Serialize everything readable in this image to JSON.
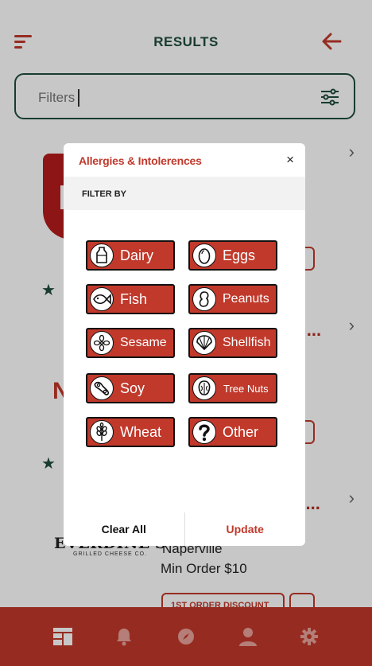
{
  "header": {
    "title": "RESULTS"
  },
  "filter": {
    "placeholder": "Filters"
  },
  "restaurants": [
    {
      "peek_name": "i ...",
      "logo_text": ""
    },
    {
      "peek_name": "ri ...",
      "logo_text": "N"
    },
    {
      "peek_name": "d ...",
      "logo_text": "EVERDINE'S",
      "logo_sub": "GRILLED CHEESE CO.",
      "location": "Naperville",
      "min_order": "Min Order $10",
      "badge": "1ST ORDER DISCOUNT"
    }
  ],
  "modal": {
    "title": "Allergies & Intolerences",
    "close_label": "×",
    "filter_by_label": "FILTER BY",
    "allergens": [
      {
        "label": "Dairy",
        "icon": "milk-bottle-icon"
      },
      {
        "label": "Eggs",
        "icon": "egg-icon"
      },
      {
        "label": "Fish",
        "icon": "fish-icon"
      },
      {
        "label": "Peanuts",
        "icon": "peanut-icon"
      },
      {
        "label": "Sesame",
        "icon": "sesame-icon"
      },
      {
        "label": "Shellfish",
        "icon": "shell-icon"
      },
      {
        "label": "Soy",
        "icon": "soy-icon"
      },
      {
        "label": "Tree Nuts",
        "icon": "tree-nut-icon"
      },
      {
        "label": "Wheat",
        "icon": "wheat-icon"
      },
      {
        "label": "Other",
        "icon": "question-icon"
      }
    ],
    "clear_label": "Clear All",
    "update_label": "Update"
  },
  "nav": [
    {
      "name": "home",
      "icon": "dashboard-icon"
    },
    {
      "name": "notifications",
      "icon": "bell-icon"
    },
    {
      "name": "explore",
      "icon": "compass-icon"
    },
    {
      "name": "profile",
      "icon": "user-icon"
    },
    {
      "name": "settings",
      "icon": "gear-icon"
    }
  ],
  "colors": {
    "brand_red": "#c0392b",
    "brand_green": "#1f4d3a"
  }
}
